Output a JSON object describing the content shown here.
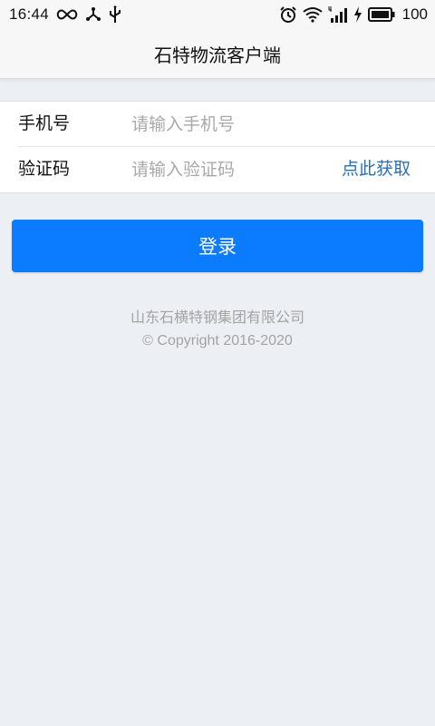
{
  "status_bar": {
    "time": "16:44",
    "battery_level": "100",
    "icons_left": [
      "infinity-icon",
      "share-nodes-icon",
      "usb-icon"
    ],
    "icons_right": [
      "alarm-icon",
      "wifi-icon",
      "signal-4g-icon",
      "charging-icon",
      "battery-icon"
    ]
  },
  "header": {
    "title": "石特物流客户端"
  },
  "form": {
    "phone": {
      "label": "手机号",
      "value": "",
      "placeholder": "请输入手机号"
    },
    "code": {
      "label": "验证码",
      "value": "",
      "placeholder": "请输入验证码",
      "get_code_label": "点此获取"
    }
  },
  "login": {
    "label": "登录"
  },
  "footer": {
    "company": "山东石横特钢集团有限公司",
    "copyright": "© Copyright 2016-2020"
  },
  "colors": {
    "accent": "#0b7cff",
    "link": "#2a6fb6",
    "background": "#eceff3"
  }
}
